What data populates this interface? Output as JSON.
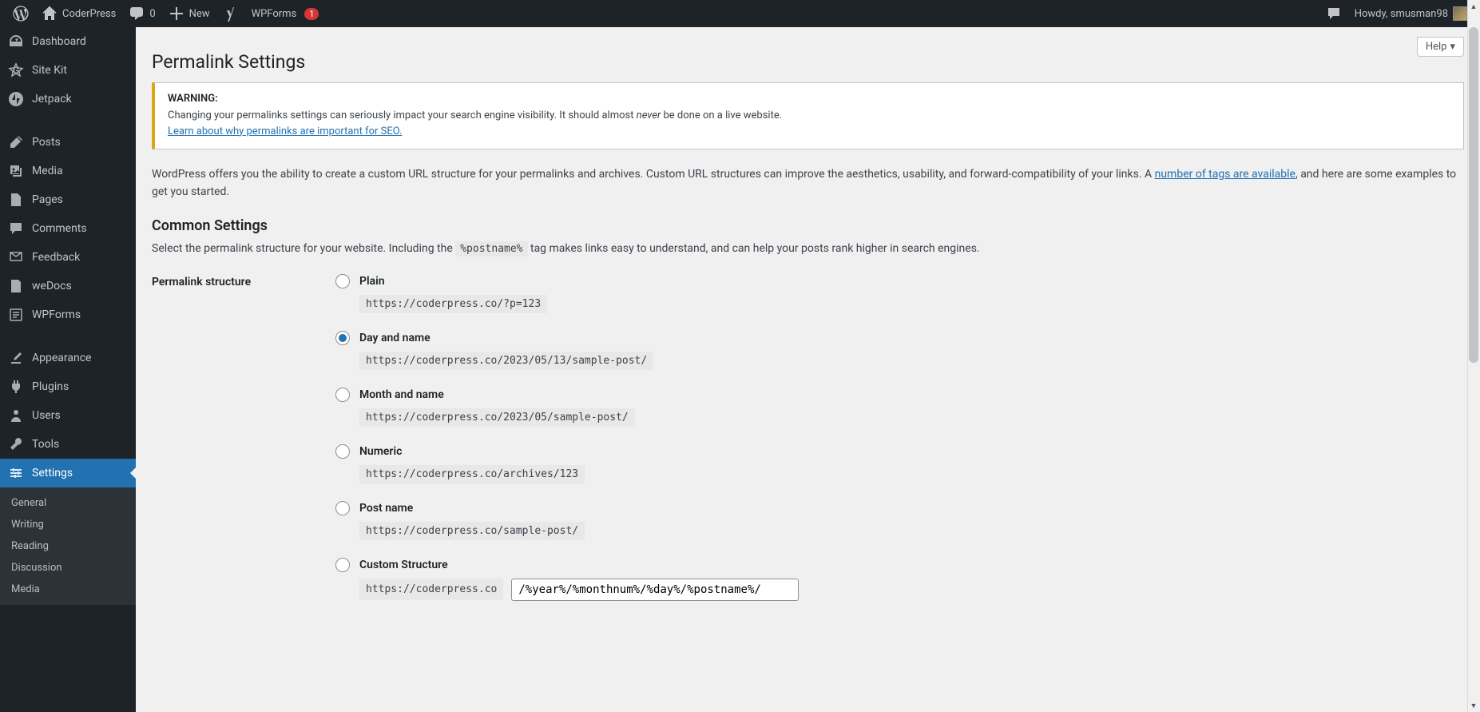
{
  "adminbar": {
    "site_name": "CoderPress",
    "comments_count": "0",
    "new_label": "New",
    "wpforms_label": "WPForms",
    "wpforms_badge": "1",
    "howdy": "Howdy, smusman98"
  },
  "sidebar": {
    "items": [
      {
        "label": "Dashboard"
      },
      {
        "label": "Site Kit"
      },
      {
        "label": "Jetpack"
      },
      {
        "sep": true
      },
      {
        "label": "Posts"
      },
      {
        "label": "Media"
      },
      {
        "label": "Pages"
      },
      {
        "label": "Comments"
      },
      {
        "label": "Feedback"
      },
      {
        "label": "weDocs"
      },
      {
        "label": "WPForms"
      },
      {
        "sep": true
      },
      {
        "label": "Appearance"
      },
      {
        "label": "Plugins"
      },
      {
        "label": "Users"
      },
      {
        "label": "Tools"
      },
      {
        "label": "Settings",
        "current": true
      }
    ],
    "submenu": [
      {
        "label": "General"
      },
      {
        "label": "Writing"
      },
      {
        "label": "Reading"
      },
      {
        "label": "Discussion"
      },
      {
        "label": "Media"
      }
    ]
  },
  "help_label": "Help",
  "page_title": "Permalink Settings",
  "notice": {
    "heading": "WARNING:",
    "text_pre": "Changing your permalinks settings can seriously impact your search engine visibility. It should almost ",
    "text_em": "never",
    "text_post": " be done on a live website.",
    "link": "Learn about why permalinks are important for SEO."
  },
  "intro": {
    "pre": "WordPress offers you the ability to create a custom URL structure for your permalinks and archives. Custom URL structures can improve the aesthetics, usability, and forward-compatibility of your links. A ",
    "link": "number of tags are available",
    "post": ", and here are some examples to get you started."
  },
  "common_heading": "Common Settings",
  "common_desc_pre": "Select the permalink structure for your website. Including the ",
  "common_desc_tag": "%postname%",
  "common_desc_post": " tag makes links easy to understand, and can help your posts rank higher in search engines.",
  "structure_label": "Permalink structure",
  "options": [
    {
      "label": "Plain",
      "example": "https://coderpress.co/?p=123",
      "checked": false
    },
    {
      "label": "Day and name",
      "example": "https://coderpress.co/2023/05/13/sample-post/",
      "checked": true
    },
    {
      "label": "Month and name",
      "example": "https://coderpress.co/2023/05/sample-post/",
      "checked": false
    },
    {
      "label": "Numeric",
      "example": "https://coderpress.co/archives/123",
      "checked": false
    },
    {
      "label": "Post name",
      "example": "https://coderpress.co/sample-post/",
      "checked": false
    },
    {
      "label": "Custom Structure",
      "checked": false
    }
  ],
  "custom": {
    "base": "https://coderpress.co",
    "value": "/%year%/%monthnum%/%day%/%postname%/"
  }
}
